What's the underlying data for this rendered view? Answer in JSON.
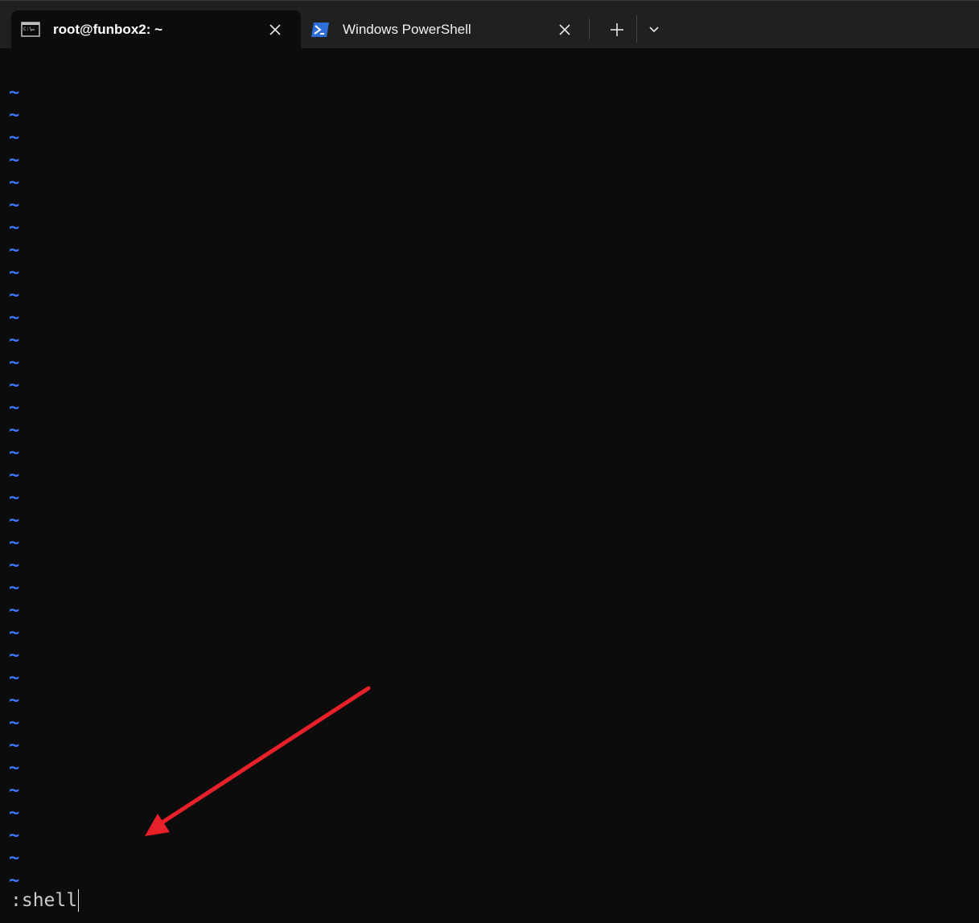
{
  "tabs": [
    {
      "label": "root@funbox2: ~",
      "icon": "command-prompt-icon",
      "active": true
    },
    {
      "label": "Windows PowerShell",
      "icon": "powershell-icon",
      "active": false
    }
  ],
  "toolbar": {
    "new_tab_icon": "plus-icon",
    "dropdown_icon": "chevron-down-icon"
  },
  "terminal": {
    "empty_line_marker": "~",
    "empty_line_count": 36,
    "command_line": ":shell"
  },
  "colors": {
    "tabbar_background": "#202020",
    "terminal_background": "#0c0c0c",
    "tilde_color": "#3b78ff",
    "command_text_color": "#cccccc",
    "annotation_arrow_color": "#e8202a"
  }
}
